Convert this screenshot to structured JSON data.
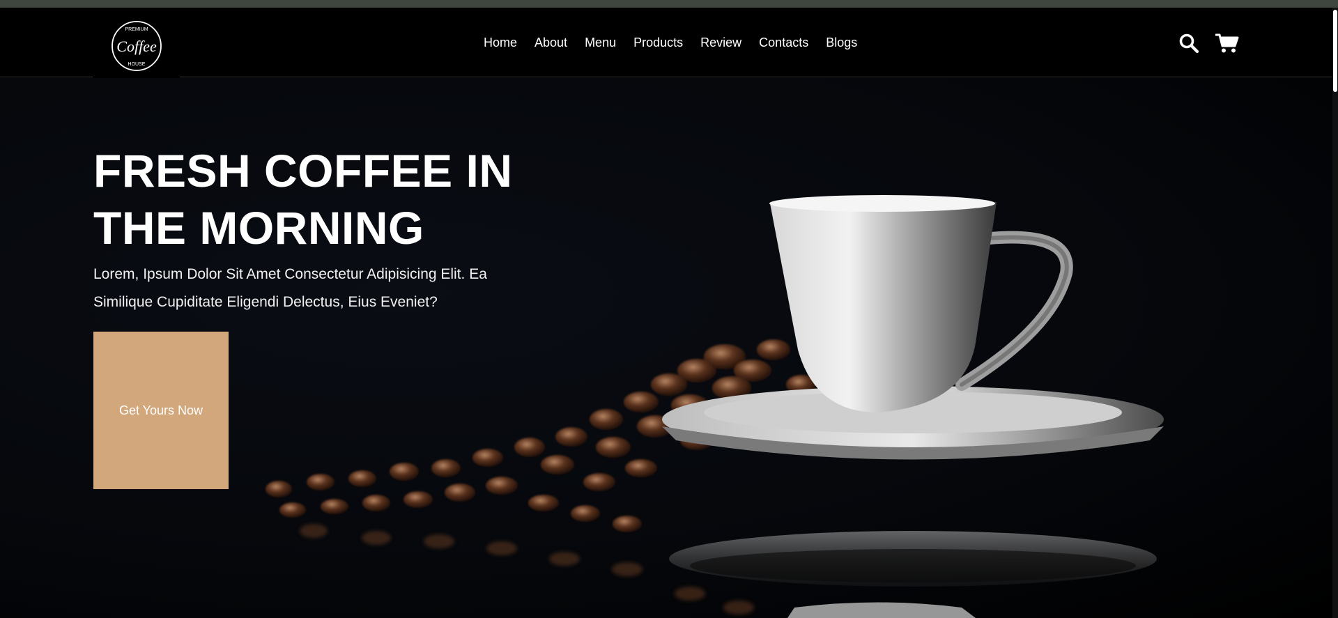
{
  "header": {
    "logo_text": "Coffee",
    "logo_top_text": "PREMIUM",
    "logo_bottom_text": "HOUSE",
    "nav": [
      {
        "label": "Home"
      },
      {
        "label": "About"
      },
      {
        "label": "Menu"
      },
      {
        "label": "Products"
      },
      {
        "label": "Review"
      },
      {
        "label": "Contacts"
      },
      {
        "label": "Blogs"
      }
    ],
    "icons": {
      "search": "search-icon",
      "cart": "cart-icon"
    }
  },
  "hero": {
    "title_line1": "FRESH COFFEE IN",
    "title_line2": "THE MORNING",
    "subtitle": "Lorem, Ipsum Dolor Sit Amet Consectetur Adipisicing Elit. Ea Similique Cupiditate Eligendi Delectus, Eius Eveniet?",
    "cta_label": "Get Yours Now"
  },
  "colors": {
    "accent": "#d2a77c",
    "background": "#000000",
    "top_strip": "#3f4640"
  }
}
